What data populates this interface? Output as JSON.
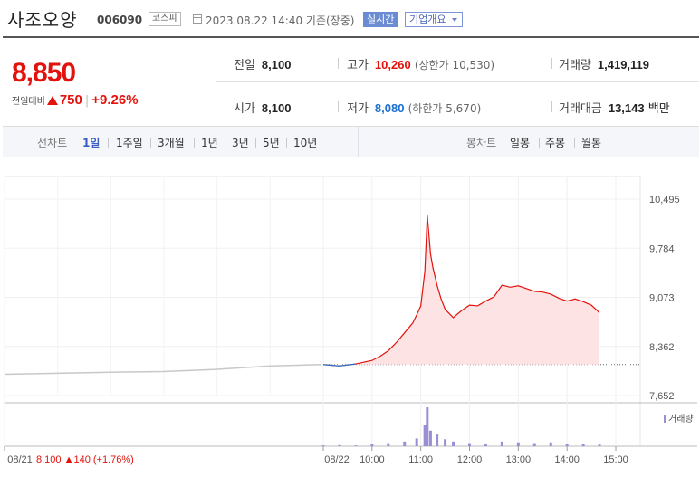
{
  "header": {
    "name": "사조오양",
    "code": "006090",
    "market": "코스피",
    "timestamp": "2023.08.22 14:40 기준(장중)",
    "realtime_label": "실시간",
    "overview_label": "기업개요"
  },
  "price": {
    "current": "8,850",
    "change_label": "전일대비",
    "change": "750",
    "change_rate": "+9.26%"
  },
  "stats": {
    "prev_close": {
      "label": "전일",
      "value": "8,100"
    },
    "high": {
      "label": "고가",
      "value": "10,260",
      "limit": "(상한가 10,530)"
    },
    "volume": {
      "label": "거래량",
      "value": "1,419,119"
    },
    "open": {
      "label": "시가",
      "value": "8,100"
    },
    "low": {
      "label": "저가",
      "value": "8,080",
      "limit": "(하한가 5,670)"
    },
    "amount": {
      "label": "거래대금",
      "value": "13,143",
      "unit": "백만"
    }
  },
  "period_tabs": {
    "line_label": "선차트",
    "items": [
      "1일",
      "1주일",
      "3개월",
      "1년",
      "3년",
      "5년",
      "10년"
    ],
    "active": "1일",
    "candle_label": "봉차트",
    "candle_items": [
      "일봉",
      "주봉",
      "월봉"
    ]
  },
  "colors": {
    "up": "#e3120c",
    "down": "#1a6fd0",
    "accent": "#3b5fc0",
    "fill": "#fde3e3",
    "volume": "#9b8fd3",
    "prev_line": "#c8c8c8"
  },
  "chart_data": {
    "type": "line",
    "y_ticks": [
      "10,495",
      "9,784",
      "9,073",
      "8,362",
      "7,652"
    ],
    "ylim": [
      7652,
      10495
    ],
    "x_ticks": [
      "08/21",
      "08/22",
      "10:00",
      "11:00",
      "12:00",
      "13:00",
      "14:00",
      "15:00"
    ],
    "prev_day_label": "08/21",
    "prev_day_close": "8,100",
    "prev_day_change": "140",
    "prev_day_rate": "(+1.76%)",
    "volume_legend": "거래량",
    "grid": true,
    "baseline": 8100,
    "series": [
      {
        "x": [
          "08/21 09:00",
          "08/21 10:00",
          "08/21 11:00",
          "08/21 12:00",
          "08/21 13:00",
          "08/21 14:00",
          "08/21 15:00"
        ],
        "y": [
          7960,
          7975,
          7990,
          8000,
          8030,
          8080,
          8100
        ]
      },
      {
        "x": [
          "09:00",
          "09:20",
          "09:40",
          "10:00",
          "10:10",
          "10:20",
          "10:30",
          "10:40",
          "10:50",
          "10:55",
          "11:00",
          "11:05",
          "11:08",
          "11:12",
          "11:15",
          "11:20",
          "11:25",
          "11:30",
          "11:40",
          "11:50",
          "12:00",
          "12:10",
          "12:20",
          "12:30",
          "12:40",
          "12:50",
          "13:00",
          "13:10",
          "13:20",
          "13:30",
          "13:40",
          "13:50",
          "14:00",
          "14:10",
          "14:20",
          "14:30",
          "14:40"
        ],
        "y": [
          8100,
          8080,
          8110,
          8160,
          8220,
          8300,
          8420,
          8560,
          8700,
          8820,
          8950,
          9450,
          10260,
          9700,
          9500,
          9250,
          9050,
          8900,
          8780,
          8880,
          8960,
          8950,
          9020,
          9080,
          9250,
          9220,
          9240,
          9200,
          9160,
          9150,
          9120,
          9060,
          9020,
          9050,
          9010,
          8960,
          8850
        ]
      }
    ],
    "volume": {
      "x": [
        "09:00",
        "09:20",
        "09:40",
        "10:00",
        "10:20",
        "10:40",
        "10:55",
        "11:05",
        "11:08",
        "11:12",
        "11:20",
        "11:30",
        "11:40",
        "12:00",
        "12:20",
        "12:40",
        "13:00",
        "13:20",
        "13:40",
        "14:00",
        "14:20",
        "14:40"
      ],
      "values": [
        2,
        3,
        2,
        5,
        8,
        12,
        20,
        55,
        100,
        40,
        30,
        18,
        12,
        8,
        7,
        12,
        10,
        8,
        10,
        6,
        5,
        4
      ]
    }
  }
}
